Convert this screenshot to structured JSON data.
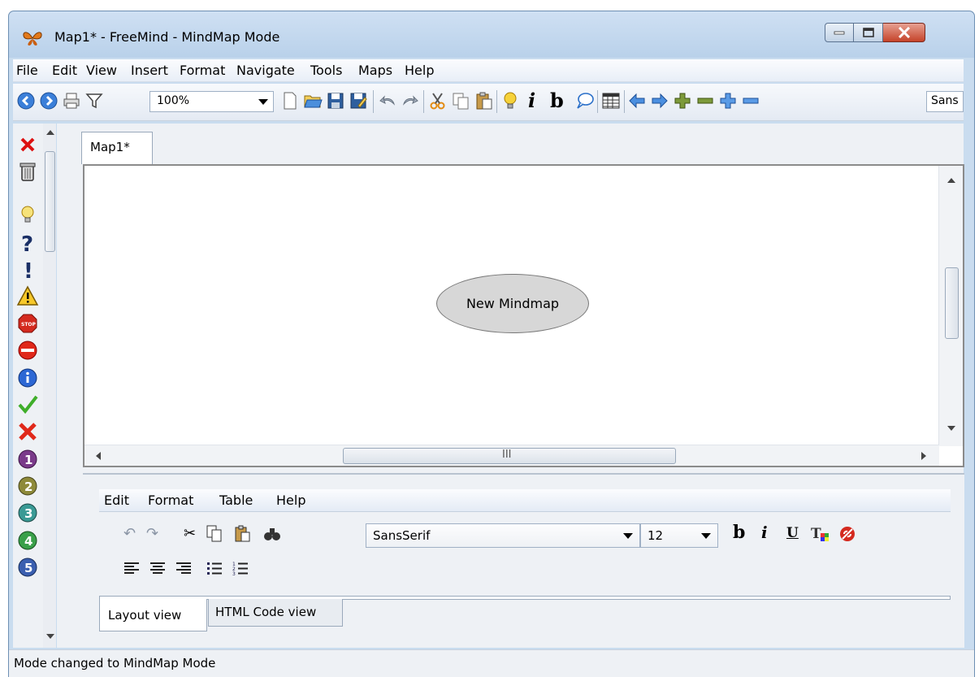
{
  "window": {
    "title": "Map1* - FreeMind - MindMap Mode"
  },
  "menubar": {
    "items": [
      "File",
      "Edit",
      "View",
      "Insert",
      "Format",
      "Navigate",
      "Tools",
      "Maps",
      "Help"
    ]
  },
  "toolbar": {
    "zoom_value": "100%",
    "font_value": "Sans",
    "italic_label": "i",
    "bold_label": "b"
  },
  "tabs": {
    "map_tab": "Map1*"
  },
  "mindmap": {
    "root_node": "New Mindmap"
  },
  "scrollbar": {
    "h_grip": "III"
  },
  "editor": {
    "menu": [
      "Edit",
      "Format",
      "Table",
      "Help"
    ],
    "font_family": "SansSerif",
    "font_size": "12",
    "bold_label": "b",
    "italic_label": "i",
    "underline_label": "U",
    "tabs": [
      "Layout view",
      "HTML Code view"
    ]
  },
  "status": {
    "text": "Mode changed to MindMap Mode"
  },
  "colors": {
    "title_gradient": "#c9dcef",
    "close_button": "#c5432a",
    "node_fill": "#d7d7d7",
    "accent_blue": "#2a6fc9"
  }
}
